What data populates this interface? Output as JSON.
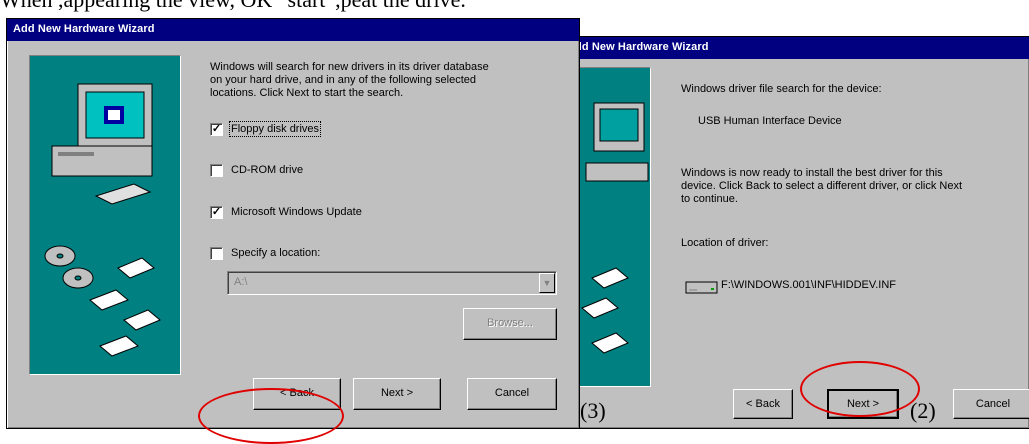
{
  "caption_top": "When ,appearing the view, OK “start”,peat the drive.",
  "left_window": {
    "title": "Add New Hardware Wizard",
    "intro_line1": "Windows will search for new drivers in its driver database",
    "intro_line2": "on your hard drive, and in any of the following selected",
    "intro_line3": "locations. Click Next to start the search.",
    "options": [
      {
        "label": "Floppy disk drives",
        "checked": true
      },
      {
        "label": "CD-ROM drive",
        "checked": false
      },
      {
        "label": "Microsoft Windows Update",
        "checked": true
      },
      {
        "label": "Specify a location:",
        "checked": false
      }
    ],
    "location_value": "A:\\",
    "browse_label": "Browse...",
    "back_label": "< Back",
    "next_label": "Next >",
    "cancel_label": "Cancel",
    "step": "(3)"
  },
  "right_window": {
    "title": "Add New Hardware Wizard",
    "search_label": "Windows driver file search for the device:",
    "device_name": "USB Human Interface Device",
    "ready_line1": "Windows is now ready to install the best driver for this",
    "ready_line2": "device. Click Back to select a different driver, or click Next",
    "ready_line3": "to continue.",
    "location_label": "Location of driver:",
    "driver_path": "F:\\WINDOWS.001\\INF\\HIDDEV.INF",
    "back_label": "< Back",
    "next_label": "Next >",
    "cancel_label": "Cancel",
    "step": "(2)"
  },
  "colors": {
    "title_bar": "#000080",
    "panel": "#008080",
    "face": "#c0c0c0",
    "highlight": "#e00000"
  }
}
